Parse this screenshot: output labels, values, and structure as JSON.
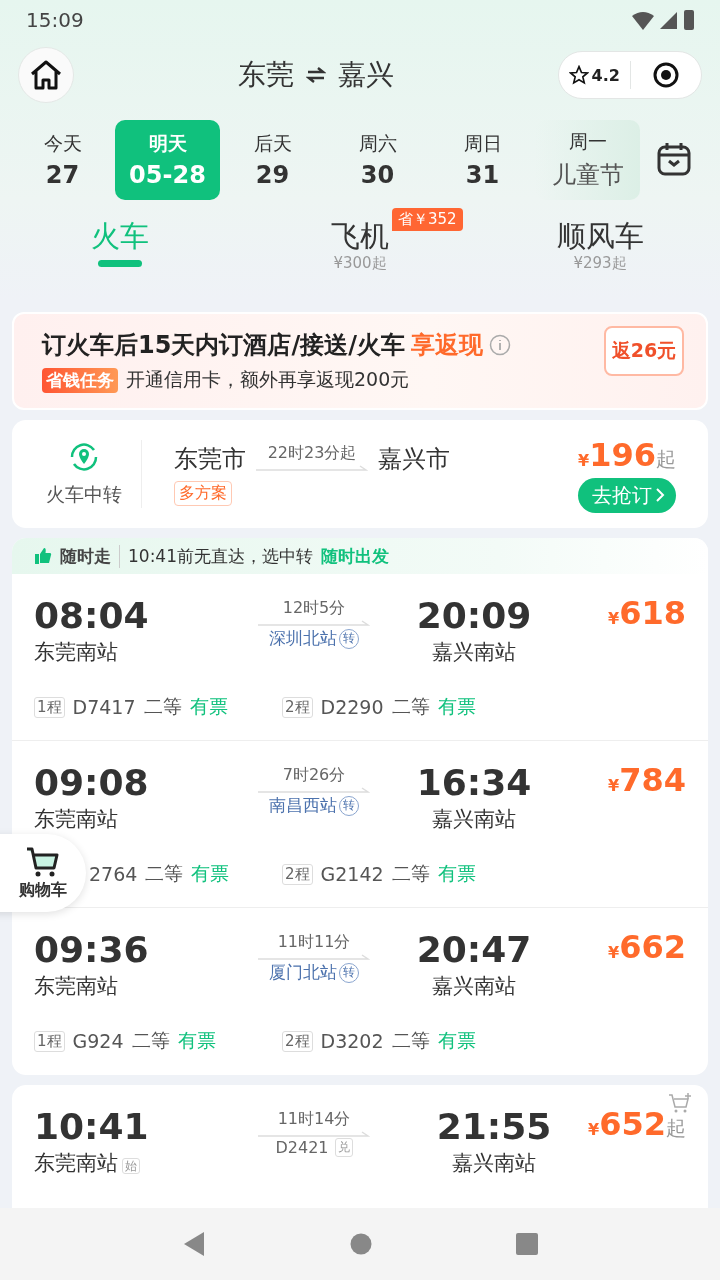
{
  "status_bar": {
    "time": "15:09"
  },
  "header": {
    "from": "东莞",
    "to": "嘉兴",
    "rating": "4.2"
  },
  "dates": [
    {
      "kind": "day",
      "label": "今天",
      "value": "27",
      "selected": false
    },
    {
      "kind": "day",
      "label": "明天",
      "value": "05-28",
      "selected": true
    },
    {
      "kind": "day",
      "label": "后天",
      "value": "29",
      "selected": false
    },
    {
      "kind": "day",
      "label": "周六",
      "value": "30",
      "selected": false
    },
    {
      "kind": "day",
      "label": "周日",
      "value": "31",
      "selected": false
    },
    {
      "kind": "holiday",
      "label": "周一",
      "value": "儿童节",
      "selected": false
    }
  ],
  "tabs": [
    {
      "label": "火车",
      "selected": true
    },
    {
      "label": "飞机",
      "sub": "¥300起",
      "badge": "省￥352",
      "selected": false
    },
    {
      "label": "顺风车",
      "sub": "¥293起",
      "selected": false
    }
  ],
  "promo": {
    "title": "订火车后15天内订酒店/接送/火车",
    "highlight": "享返现",
    "tag": "省钱任务",
    "text": "开通信用卡，额外再享返现200元",
    "reward": "返26元"
  },
  "transfer": {
    "label": "火车中转",
    "from": "东莞市",
    "to": "嘉兴市",
    "duration": "22时23分起",
    "tag": "多方案",
    "currency": "¥",
    "price": "196",
    "suffix": "起",
    "button": "去抢订"
  },
  "list_header": {
    "badge": "随时走",
    "text": "10:41前无直达，选中转",
    "highlight": "随时出发"
  },
  "trips": [
    {
      "dep_time": "08:04",
      "dep_station": "东莞南站",
      "duration": "12时5分",
      "via": "深圳北站",
      "via_tag": "转",
      "arr_time": "20:09",
      "arr_station": "嘉兴南站",
      "currency": "¥",
      "price": "618",
      "legs": [
        {
          "label": "1程",
          "train": "D7417",
          "seat": "二等",
          "availability": "有票"
        },
        {
          "label": "2程",
          "train": "D2290",
          "seat": "二等",
          "availability": "有票"
        }
      ]
    },
    {
      "dep_time": "09:08",
      "dep_station": "东莞南站",
      "duration": "7时26分",
      "via": "南昌西站",
      "via_tag": "转",
      "arr_time": "16:34",
      "arr_station": "嘉兴南站",
      "currency": "¥",
      "price": "784",
      "legs": [
        {
          "train": "2764",
          "seat": "二等",
          "availability": "有票"
        },
        {
          "label": "2程",
          "train": "G2142",
          "seat": "二等",
          "availability": "有票"
        }
      ]
    },
    {
      "dep_time": "09:36",
      "dep_station": "东莞南站",
      "duration": "11时11分",
      "via": "厦门北站",
      "via_tag": "转",
      "arr_time": "20:47",
      "arr_station": "嘉兴南站",
      "currency": "¥",
      "price": "662",
      "legs": [
        {
          "label": "1程",
          "train": "G924",
          "seat": "二等",
          "availability": "有票"
        },
        {
          "label": "2程",
          "train": "D3202",
          "seat": "二等",
          "availability": "有票"
        }
      ]
    }
  ],
  "direct_trip": {
    "dep_time": "10:41",
    "dep_station": "东莞南站",
    "dep_tag": "始",
    "duration": "11时14分",
    "train": "D2421",
    "train_tag": "兑",
    "arr_time": "21:55",
    "arr_station": "嘉兴南站",
    "currency": "¥",
    "price": "652",
    "suffix": "起"
  },
  "cart": {
    "label": "购物车"
  }
}
